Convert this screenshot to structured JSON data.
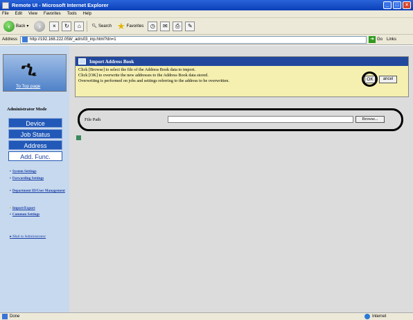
{
  "window": {
    "title": "Remote UI - Microsoft Internet Explorer"
  },
  "menu": [
    "File",
    "Edit",
    "View",
    "Favorites",
    "Tools",
    "Help"
  ],
  "toolbar": {
    "back": "Back",
    "search": "Search",
    "favorites": "Favorites"
  },
  "address": {
    "label": "Address",
    "url": "http://192.168.222.058/_adrs03_inp.html?dn=1",
    "go": "Go",
    "links": "Links"
  },
  "sidebar": {
    "top_page": "To Top page",
    "mode": "Administrator Mode",
    "nav": [
      "Device",
      "Job Status",
      "Address",
      "Add. Func."
    ],
    "links": [
      "System Settings",
      "Forwarding Settings",
      "Department ID/User Management",
      "Import/Export",
      "Common Settings"
    ],
    "mail": "Mail to Administrator"
  },
  "panel": {
    "title": "Import Address Book",
    "lines": [
      "Click [Browse] to select the file of the Address Book data to import.",
      "Click [OK] to overwrite the new addresses to the Address Book data stored.",
      "Overwriting is performed on jobs and settings referring to the address to be overwritten."
    ],
    "ok": "OK",
    "cancel": "ancel"
  },
  "file": {
    "label": "File Path",
    "browse": "Browse..."
  },
  "status": {
    "left": "Done",
    "zone": "Internet"
  }
}
